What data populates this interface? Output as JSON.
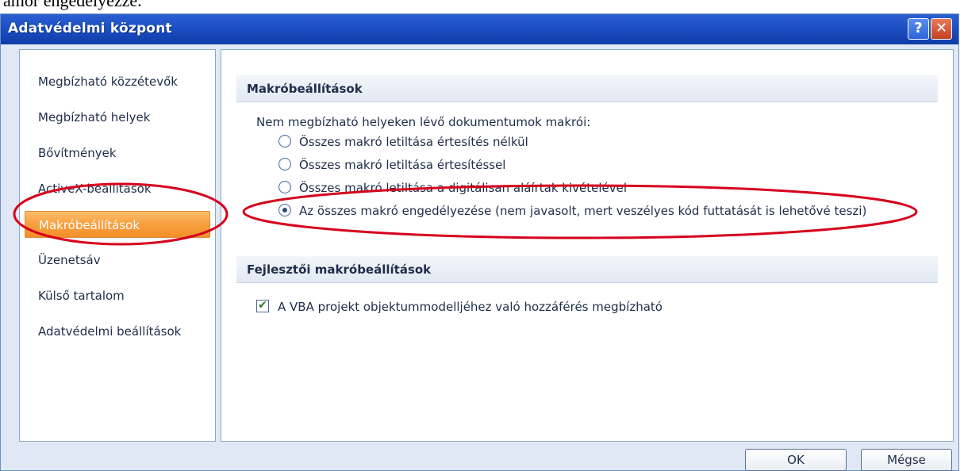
{
  "document_fragment": "amor engedelyezze.",
  "window": {
    "title": "Adatvédelmi központ",
    "help_glyph": "?",
    "close_glyph": "✕"
  },
  "sidebar": {
    "items": [
      {
        "label": "Megbízható közzétevők",
        "active": false
      },
      {
        "label": "Megbízható helyek",
        "active": false
      },
      {
        "label": "Bővítmények",
        "active": false
      },
      {
        "label": "ActiveX-beállítások",
        "active": false
      },
      {
        "label": "Makróbeállítások",
        "active": true
      },
      {
        "label": "Üzenetsáv",
        "active": false
      },
      {
        "label": "Külső tartalom",
        "active": false
      },
      {
        "label": "Adatvédelmi beállítások",
        "active": false
      }
    ]
  },
  "macro_settings": {
    "header": "Makróbeállítások",
    "group_label": "Nem megbízható helyeken lévő dokumentumok makrói:",
    "options": [
      {
        "label": "Összes makró letiltása értesítés nélkül",
        "checked": false
      },
      {
        "label": "Összes makró letiltása értesítéssel",
        "checked": false
      },
      {
        "label": "Összes makró letiltása a digitálisan aláírtak kivételével",
        "checked": false
      },
      {
        "label": "Az összes makró engedélyezése (nem javasolt, mert veszélyes kód futtatását is lehetővé teszi)",
        "checked": true
      }
    ]
  },
  "developer_settings": {
    "header": "Fejlesztői makróbeállítások",
    "vba_access_label": "A VBA projekt objektummodelljéhez való hozzáférés megbízható",
    "vba_access_checked": true,
    "check_glyph": "✔"
  },
  "buttons": {
    "ok": "OK",
    "cancel": "Mégse"
  },
  "colors": {
    "title_bar": "#1d4fc4",
    "active_item": "#f8a141",
    "annotation": "#d6001c"
  }
}
